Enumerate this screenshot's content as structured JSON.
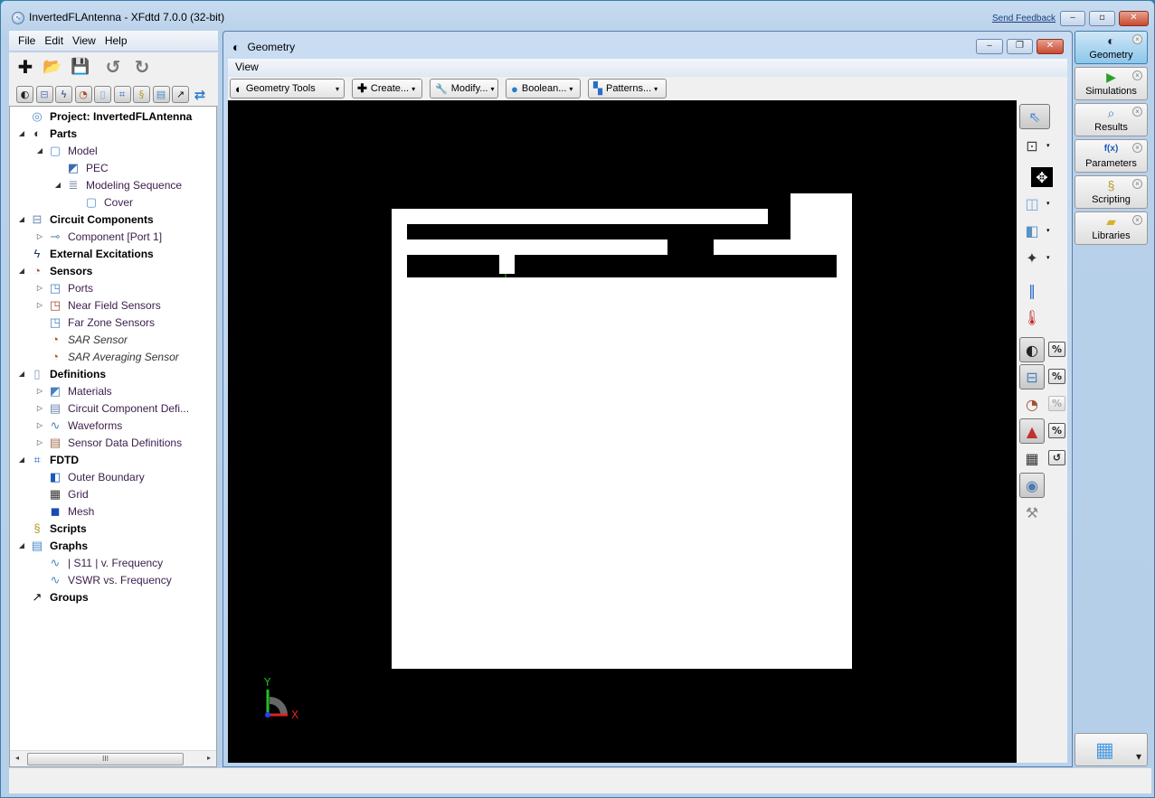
{
  "window": {
    "title": "InvertedFLAntenna - XFdtd 7.0.0 (32-bit)",
    "send_feedback": "Send Feedback",
    "controls": {
      "minimize": "‒",
      "maximize": "▫",
      "close": "✕"
    }
  },
  "main_menu": [
    "File",
    "Edit",
    "View",
    "Help"
  ],
  "main_toolbar": [
    {
      "icon": "new-project-icon",
      "glyph": "✚"
    },
    {
      "icon": "open-project-icon",
      "glyph": "📂"
    },
    {
      "icon": "save-icon",
      "glyph": "💾"
    },
    {
      "icon": "undo-icon",
      "glyph": "↺"
    },
    {
      "icon": "redo-icon",
      "glyph": "↻"
    }
  ],
  "filter_toolbar": [
    {
      "icon": "parts-filter-icon",
      "glyph": "◐"
    },
    {
      "icon": "circuit-filter-icon",
      "glyph": "⊟"
    },
    {
      "icon": "excitation-filter-icon",
      "glyph": "ϟ"
    },
    {
      "icon": "sensor-filter-icon",
      "glyph": "◔"
    },
    {
      "icon": "definitions-filter-icon",
      "glyph": "▯"
    },
    {
      "icon": "fdtd-filter-icon",
      "glyph": "⌗"
    },
    {
      "icon": "scripts-filter-icon",
      "glyph": "§"
    },
    {
      "icon": "graphs-filter-icon",
      "glyph": "▤"
    },
    {
      "icon": "groups-filter-icon",
      "glyph": "↗"
    },
    {
      "icon": "sync-icon",
      "glyph": "⇄"
    }
  ],
  "project_tree": [
    {
      "label": "Project: InvertedFLAntenna",
      "level": 0,
      "expander": "",
      "style": "bold",
      "icon": "project-icon",
      "glyph": "◎"
    },
    {
      "label": "Parts",
      "level": 0,
      "expander": "◢",
      "style": "bold",
      "icon": "parts-icon",
      "glyph": "◐"
    },
    {
      "label": "Model",
      "level": 1,
      "expander": "◢",
      "style": "child",
      "icon": "model-icon",
      "glyph": "▢"
    },
    {
      "label": "PEC",
      "level": 2,
      "expander": "",
      "style": "child",
      "icon": "material-icon",
      "glyph": "◩"
    },
    {
      "label": "Modeling Sequence",
      "level": 2,
      "expander": "◢",
      "style": "child",
      "icon": "sequence-icon",
      "glyph": "≣",
      "indent_expander": true
    },
    {
      "label": "Cover",
      "level": 3,
      "expander": "",
      "style": "child",
      "icon": "cover-icon",
      "glyph": "▢"
    },
    {
      "label": "Circuit Components",
      "level": 0,
      "expander": "◢",
      "style": "bold",
      "icon": "circuit-components-icon",
      "glyph": "⊟"
    },
    {
      "label": "Component [Port 1]",
      "level": 1,
      "expander": "▷",
      "style": "child",
      "icon": "component-icon",
      "glyph": "⊸"
    },
    {
      "label": "External Excitations",
      "level": 0,
      "expander": "",
      "style": "bold",
      "icon": "excitation-icon",
      "glyph": "ϟ"
    },
    {
      "label": "Sensors",
      "level": 0,
      "expander": "◢",
      "style": "bold",
      "icon": "sensors-icon",
      "glyph": "◔"
    },
    {
      "label": "Ports",
      "level": 1,
      "expander": "▷",
      "style": "child",
      "icon": "ports-icon",
      "glyph": "◳"
    },
    {
      "label": "Near Field Sensors",
      "level": 1,
      "expander": "▷",
      "style": "child",
      "icon": "near-field-icon",
      "glyph": "◳"
    },
    {
      "label": "Far Zone Sensors",
      "level": 1,
      "expander": "",
      "style": "child",
      "icon": "far-zone-icon",
      "glyph": "◳"
    },
    {
      "label": "SAR Sensor",
      "level": 1,
      "expander": "",
      "style": "ital",
      "icon": "sar-sensor-icon",
      "glyph": "◔"
    },
    {
      "label": "SAR Averaging Sensor",
      "level": 1,
      "expander": "",
      "style": "ital",
      "icon": "sar-averaging-icon",
      "glyph": "◔"
    },
    {
      "label": "Definitions",
      "level": 0,
      "expander": "◢",
      "style": "bold",
      "icon": "definitions-icon",
      "glyph": "▯"
    },
    {
      "label": "Materials",
      "level": 1,
      "expander": "▷",
      "style": "child",
      "icon": "materials-icon",
      "glyph": "◩"
    },
    {
      "label": "Circuit Component Defi...",
      "level": 1,
      "expander": "▷",
      "style": "child",
      "icon": "circuit-def-icon",
      "glyph": "▤"
    },
    {
      "label": "Waveforms",
      "level": 1,
      "expander": "▷",
      "style": "child",
      "icon": "waveforms-icon",
      "glyph": "∿"
    },
    {
      "label": "Sensor Data Definitions",
      "level": 1,
      "expander": "▷",
      "style": "child",
      "icon": "sensor-data-icon",
      "glyph": "▤"
    },
    {
      "label": "FDTD",
      "level": 0,
      "expander": "◢",
      "style": "bold",
      "icon": "fdtd-icon",
      "glyph": "⌗"
    },
    {
      "label": "Outer Boundary",
      "level": 1,
      "expander": "",
      "style": "child",
      "icon": "outer-boundary-icon",
      "glyph": "◧"
    },
    {
      "label": "Grid",
      "level": 1,
      "expander": "",
      "style": "child",
      "icon": "grid-icon",
      "glyph": "▦"
    },
    {
      "label": "Mesh",
      "level": 1,
      "expander": "",
      "style": "child",
      "icon": "mesh-icon",
      "glyph": "◼"
    },
    {
      "label": "Scripts",
      "level": 0,
      "expander": "",
      "style": "bold",
      "icon": "scripts-icon",
      "glyph": "§"
    },
    {
      "label": "Graphs",
      "level": 0,
      "expander": "◢",
      "style": "bold",
      "icon": "graphs-icon",
      "glyph": "▤"
    },
    {
      "label": "| S11 | v. Frequency",
      "level": 1,
      "expander": "",
      "style": "child",
      "icon": "graph-icon",
      "glyph": "∿"
    },
    {
      "label": "VSWR vs. Frequency",
      "level": 1,
      "expander": "",
      "style": "child",
      "icon": "graph-icon",
      "glyph": "∿"
    },
    {
      "label": "Groups",
      "level": 0,
      "expander": "",
      "style": "bold",
      "icon": "groups-icon",
      "glyph": "↗"
    }
  ],
  "scrollbar": {
    "left_arrow": "◂",
    "right_arrow": "▸",
    "grip": "III"
  },
  "geometry_window": {
    "title": "Geometry",
    "menu": [
      "View"
    ],
    "toolbar": [
      {
        "label": "Geometry Tools",
        "icon": "geometry-tools-icon",
        "glyph": "◐",
        "caret": "▾"
      },
      {
        "label": "Create...",
        "icon": "create-icon",
        "glyph": "✚",
        "caret": "▾"
      },
      {
        "label": "Modify...",
        "icon": "modify-icon",
        "glyph": "🔧",
        "caret": "▾"
      },
      {
        "label": "Boolean...",
        "icon": "boolean-icon",
        "glyph": "●",
        "caret": "▾"
      },
      {
        "label": "Patterns...",
        "icon": "patterns-icon",
        "glyph": "▚",
        "caret": "▾"
      }
    ],
    "axes": {
      "x_label": "X",
      "y_label": "Y"
    },
    "colors": {
      "background": "#000000",
      "geometry": "#ffffff",
      "x_axis": "#e02020",
      "y_axis": "#20c020",
      "z_axis": "#2040ff"
    }
  },
  "view_tools": [
    {
      "icon": "select-arrow-icon",
      "glyph": "⇖",
      "pressed": true,
      "caret": true
    },
    {
      "icon": "zoom-region-icon",
      "glyph": "⊡",
      "pressed": false,
      "caret": true
    },
    {
      "icon": "pan-icon",
      "glyph": "✥",
      "pressed": false,
      "caret": false
    },
    {
      "icon": "view-wireframe-icon",
      "glyph": "◫",
      "pressed": false,
      "caret": true
    },
    {
      "icon": "view-solid-icon",
      "glyph": "◧",
      "pressed": false,
      "caret": true
    },
    {
      "icon": "lighting-icon",
      "glyph": "✦",
      "pressed": false,
      "caret": true
    },
    {
      "icon": "ruler-icon",
      "glyph": "‖",
      "pressed": false,
      "caret": false
    },
    {
      "icon": "thermometer-icon",
      "glyph": "🌡",
      "pressed": false,
      "caret": false
    },
    {
      "icon": "show-parts-icon",
      "glyph": "◐",
      "pressed": true,
      "pct": true,
      "pct_dim": false
    },
    {
      "icon": "show-circuits-icon",
      "glyph": "⊟",
      "pressed": true,
      "pct": true,
      "pct_dim": false
    },
    {
      "icon": "show-sensors-icon",
      "glyph": "◔",
      "pressed": false,
      "pct": true,
      "pct_dim": true
    },
    {
      "icon": "show-results-icon",
      "glyph": "▲",
      "pressed": true,
      "pct": true,
      "pct_dim": false
    },
    {
      "icon": "show-grid-icon",
      "glyph": "▦",
      "pressed": false,
      "reset": true
    },
    {
      "icon": "show-mesh-icon",
      "glyph": "◉",
      "pressed": true
    },
    {
      "icon": "tools-icon",
      "glyph": "⚒",
      "pressed": false
    }
  ],
  "pct_label": "%",
  "reset_glyph": "↺",
  "dock": [
    {
      "label": "Geometry",
      "icon": "geometry-dock-icon",
      "glyph": "◐",
      "active": true
    },
    {
      "label": "Simulations",
      "icon": "simulations-icon",
      "glyph": "▶",
      "active": false
    },
    {
      "label": "Results",
      "icon": "results-icon",
      "glyph": "⌕",
      "active": false
    },
    {
      "label": "Parameters",
      "icon": "parameters-icon",
      "glyph": "f(x)",
      "active": false
    },
    {
      "label": "Scripting",
      "icon": "scripting-icon",
      "glyph": "§",
      "active": false
    },
    {
      "label": "Libraries",
      "icon": "libraries-icon",
      "glyph": "▰",
      "active": false
    }
  ],
  "dock_close": "×",
  "dock_bottom": {
    "icon": "layout-grid-icon",
    "glyph": "▦",
    "caret": "▾"
  }
}
